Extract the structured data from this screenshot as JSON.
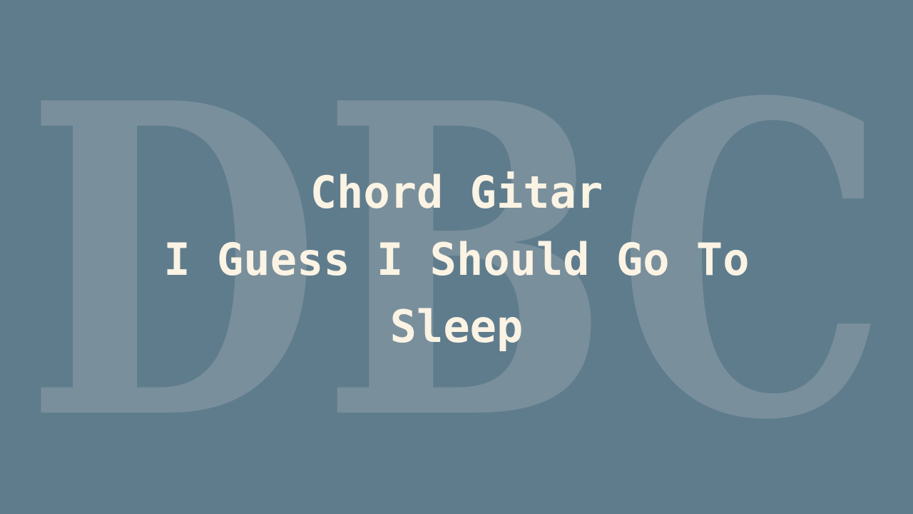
{
  "watermark": {
    "letters": "DBC",
    "color": "#7a909d"
  },
  "title": {
    "line1": "Chord Gitar",
    "line2": "I Guess I Should Go To",
    "line3": "Sleep"
  },
  "colors": {
    "background": "#5f7c8d",
    "text": "#fbf3e3"
  }
}
